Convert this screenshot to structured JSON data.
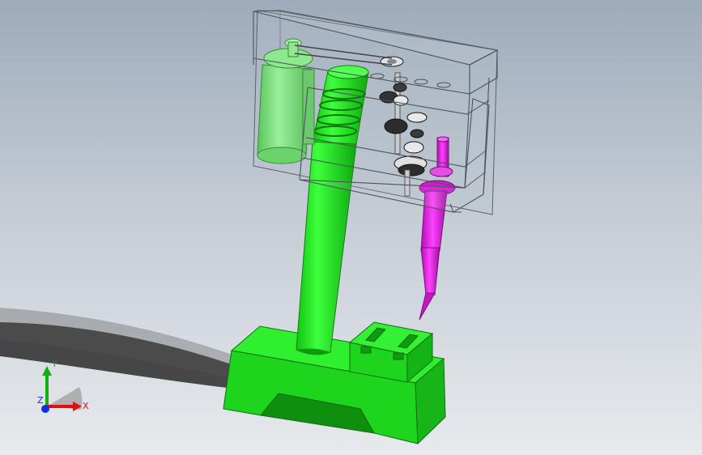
{
  "scene": {
    "description_free": true,
    "colors": {
      "background_top": "#9eabbb",
      "background_bottom": "#e7eaed",
      "structure_green": "#22ee22",
      "motor_green": "#7fe07f",
      "spindle_magenta": "#e020e0",
      "housing_edge": "#555a62",
      "gear_dark": "#2a2a2a"
    }
  },
  "triad": {
    "x_label": "X",
    "y_label": "Y",
    "z_label": "Z",
    "x_color": "#e01010",
    "y_color": "#10b010",
    "z_color": "#1030e0"
  }
}
